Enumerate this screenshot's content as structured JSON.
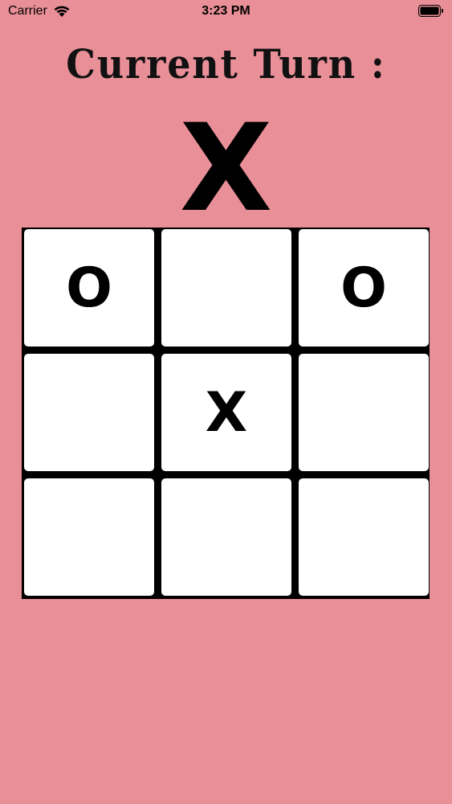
{
  "status_bar": {
    "carrier": "Carrier",
    "time": "3:23 PM",
    "icons": [
      "wifi-icon",
      "battery-icon"
    ]
  },
  "title": "Current Turn :",
  "current_turn": "X",
  "board": {
    "cells": [
      "O",
      "",
      "O",
      "",
      "X",
      "",
      "",
      "",
      ""
    ]
  },
  "colors": {
    "background": "#e98f97",
    "cell": "#ffffff",
    "grid": "#000000"
  }
}
